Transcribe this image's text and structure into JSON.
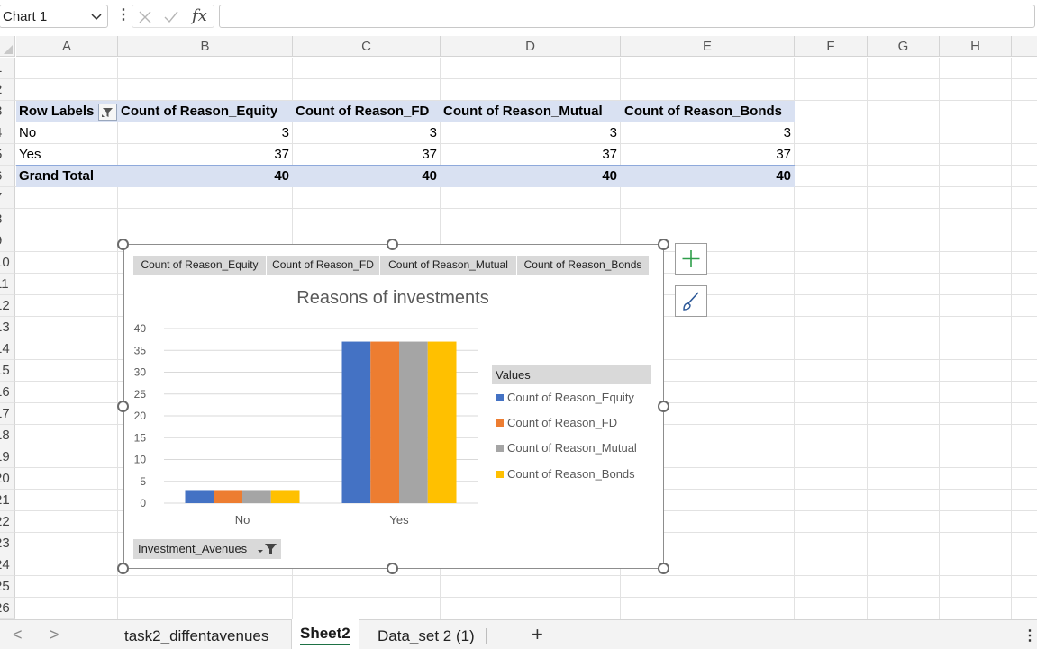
{
  "formula_bar": {
    "name_box": "Chart 1",
    "fx_label": "fx",
    "formula": ""
  },
  "columns": [
    "A",
    "B",
    "C",
    "D",
    "E",
    "F",
    "G",
    "H"
  ],
  "rows": [
    "1",
    "2",
    "3",
    "4",
    "5",
    "6",
    "7",
    "8",
    "9",
    "10",
    "11",
    "12",
    "13",
    "14",
    "15",
    "16",
    "17",
    "18",
    "19",
    "20",
    "21",
    "22",
    "23",
    "24",
    "25",
    "26"
  ],
  "pivot": {
    "headers": [
      "Row Labels",
      "Count of Reason_Equity",
      "Count of Reason_FD",
      "Count of Reason_Mutual",
      "Count of Reason_Bonds"
    ],
    "rows": [
      {
        "label": "No",
        "values": [
          "3",
          "3",
          "3",
          "3"
        ]
      },
      {
        "label": "Yes",
        "values": [
          "37",
          "37",
          "37",
          "37"
        ]
      }
    ],
    "total": {
      "label": "Grand Total",
      "values": [
        "40",
        "40",
        "40",
        "40"
      ]
    }
  },
  "chart": {
    "field_buttons": [
      "Count of Reason_Equity",
      "Count of Reason_FD",
      "Count of Reason_Mutual",
      "Count of Reason_Bonds"
    ],
    "legend_title": "Values",
    "axis_field_button": "Investment_Avenues"
  },
  "chart_data": {
    "type": "bar",
    "title": "Reasons of investments",
    "categories": [
      "No",
      "Yes"
    ],
    "series": [
      {
        "name": "Count of Reason_Equity",
        "values": [
          3,
          37
        ],
        "color": "#4472c4"
      },
      {
        "name": "Count of Reason_FD",
        "values": [
          3,
          37
        ],
        "color": "#ed7d31"
      },
      {
        "name": "Count of Reason_Mutual",
        "values": [
          3,
          37
        ],
        "color": "#a5a5a5"
      },
      {
        "name": "Count of Reason_Bonds",
        "values": [
          3,
          37
        ],
        "color": "#ffc000"
      }
    ],
    "ylim": [
      0,
      40
    ],
    "yticks": [
      "0",
      "5",
      "10",
      "15",
      "20",
      "25",
      "30",
      "35",
      "40"
    ],
    "grid": true,
    "legend": "right"
  },
  "tabs": {
    "sheets": [
      "task2_diffentavenues",
      "Sheet2",
      "Data_set 2 (1)"
    ],
    "active": "Sheet2",
    "add_label": "+"
  },
  "colors": {
    "pivot_band": "#d9e1f2",
    "accent_green": "#1e7145"
  }
}
